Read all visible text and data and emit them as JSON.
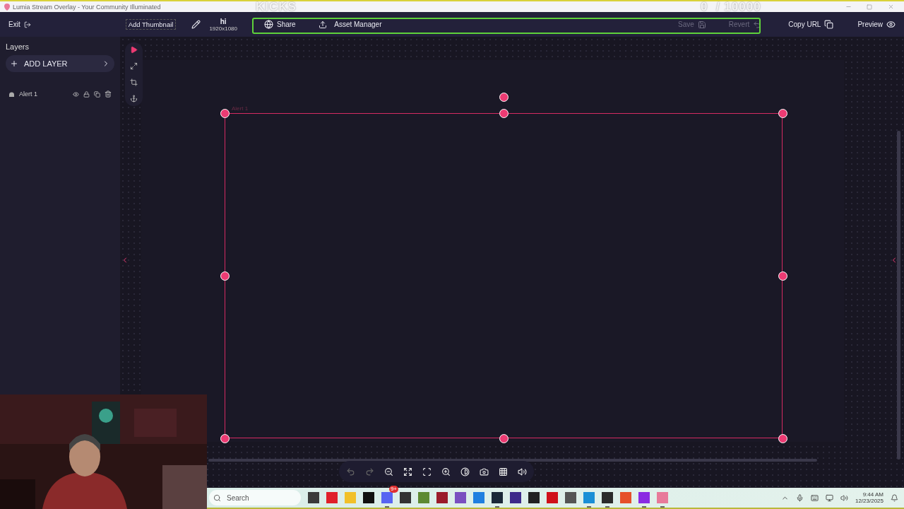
{
  "window": {
    "title": "Lumia Stream Overlay - Your Community Illuminated"
  },
  "stream_overlay": {
    "title": "KICKS",
    "counter": "0  / 10000",
    "highlight": true
  },
  "toolbar": {
    "exit": "Exit",
    "thumbnail": "Add Thumbnail",
    "overlay_name": "hi",
    "resolution": "1920x1080",
    "share": "Share",
    "asset_manager": "Asset Manager",
    "save": {
      "label": "Save",
      "disabled": true
    },
    "revert": {
      "label": "Revert",
      "disabled": true
    },
    "copy_url": "Copy URL",
    "preview": "Preview"
  },
  "layers": {
    "title": "Layers",
    "add_button": "ADD LAYER",
    "items": [
      {
        "name": "Alert 1",
        "visible": true,
        "selected": false
      }
    ]
  },
  "tools": [
    {
      "kind": "select",
      "selected": true
    },
    {
      "kind": "resize",
      "selected": false
    },
    {
      "kind": "crop",
      "selected": false
    },
    {
      "kind": "anchor",
      "selected": false
    }
  ],
  "canvas": {
    "selection_label": "Alert 1"
  },
  "view_controls": [
    {
      "kind": "undo",
      "disabled": true
    },
    {
      "kind": "redo",
      "disabled": true
    },
    {
      "kind": "zoom-out",
      "disabled": false
    },
    {
      "kind": "fit",
      "disabled": false
    },
    {
      "kind": "fullscreen",
      "disabled": false
    },
    {
      "kind": "zoom-in",
      "disabled": false
    },
    {
      "kind": "contrast",
      "disabled": false
    },
    {
      "kind": "camera",
      "disabled": false
    },
    {
      "kind": "grid",
      "disabled": false
    },
    {
      "kind": "volume",
      "disabled": false
    }
  ],
  "taskbar": {
    "search_placeholder": "Search",
    "apps": [
      {
        "color": "#3a3a3a",
        "running": false
      },
      {
        "color": "#e0202a",
        "running": false
      },
      {
        "color": "#f2c028",
        "running": false
      },
      {
        "color": "#111111",
        "running": false
      },
      {
        "color": "#5865f2",
        "running": true,
        "badge": "9+"
      },
      {
        "color": "#333333",
        "running": false
      },
      {
        "color": "#5d8a32",
        "running": false
      },
      {
        "color": "#9b1b2a",
        "running": false
      },
      {
        "color": "#7a4fc0",
        "running": false
      },
      {
        "color": "#1f7fe0",
        "running": false
      },
      {
        "color": "#1b2838",
        "running": true
      },
      {
        "color": "#3d2a8a",
        "running": false
      },
      {
        "color": "#222222",
        "running": false
      },
      {
        "color": "#d0101a",
        "running": false
      },
      {
        "color": "#555555",
        "running": false
      },
      {
        "color": "#1a8fd6",
        "running": true
      },
      {
        "color": "#2b2b2b",
        "running": true
      },
      {
        "color": "#e6502a",
        "running": false
      },
      {
        "color": "#8a2be2",
        "running": true
      },
      {
        "color": "#e87a9a",
        "running": true
      }
    ],
    "time": "9:44 AM",
    "date": "12/23/2025"
  }
}
